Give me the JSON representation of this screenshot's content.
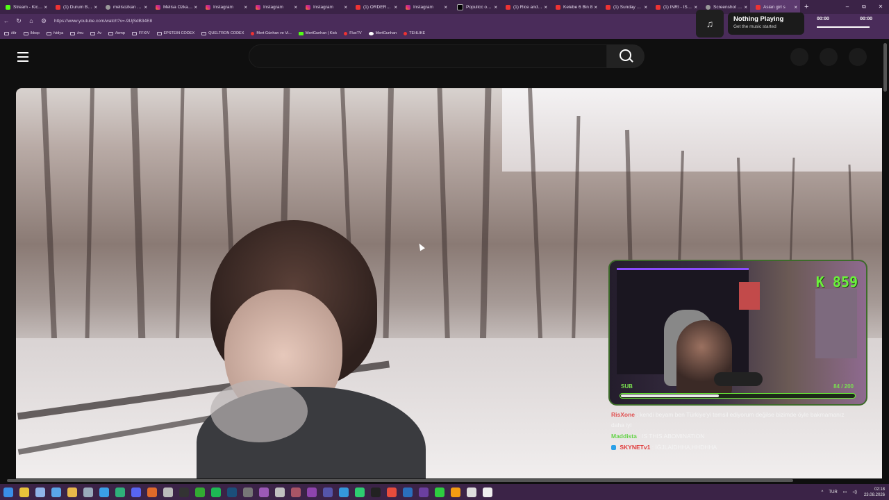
{
  "browser": {
    "tabs": [
      {
        "title": "Stream - Kick Dc",
        "icon": "kick",
        "active": false
      },
      {
        "title": "(1) Durum Boyle",
        "icon": "youtube",
        "active": false
      },
      {
        "title": "melisozkan - Goo",
        "icon": "google",
        "active": false
      },
      {
        "title": "Melisa Ozkan (@",
        "icon": "instagram",
        "active": false
      },
      {
        "title": "Instagram",
        "icon": "instagram",
        "active": false
      },
      {
        "title": "Instagram",
        "icon": "instagram",
        "active": false
      },
      {
        "title": "Instagram",
        "icon": "instagram",
        "active": false
      },
      {
        "title": "(1) ORDERED D",
        "icon": "youtube",
        "active": false
      },
      {
        "title": "Instagram",
        "icon": "instagram",
        "active": false
      },
      {
        "title": "Populicc on X: \"J",
        "icon": "x",
        "active": false
      },
      {
        "title": "(1) Rice and Chi",
        "icon": "youtube",
        "active": false
      },
      {
        "title": "Kelebe 6 Bin 8",
        "icon": "youtube",
        "active": false
      },
      {
        "title": "(1) Sunday dinn",
        "icon": "youtube",
        "active": false
      },
      {
        "title": "(1) INRI - ISTANI",
        "icon": "youtube",
        "active": false
      },
      {
        "title": "Screenshot by Li",
        "icon": "google",
        "active": false
      },
      {
        "title": "Asian girl s",
        "icon": "youtube",
        "active": true
      }
    ],
    "new_tab": "+",
    "window_controls": [
      "–",
      "⧉",
      "✕"
    ],
    "url": "https://www.youtube.com/watch?v=-9UjSdB34E8",
    "bookmarks": [
      {
        "label": "/dir",
        "icon": "folder"
      },
      {
        "label": "/kkop",
        "icon": "folder"
      },
      {
        "label": "/vidya",
        "icon": "folder"
      },
      {
        "label": "/mu",
        "icon": "folder"
      },
      {
        "label": "/tv",
        "icon": "folder"
      },
      {
        "label": "/temp",
        "icon": "folder"
      },
      {
        "label": "FFXIV",
        "icon": "folder"
      },
      {
        "label": "EPSTEIN CODEX",
        "icon": "folder"
      },
      {
        "label": "QUELTRON CODEX",
        "icon": "folder"
      },
      {
        "label": "Mert Günhan ve Vi...",
        "icon": "youtube"
      },
      {
        "label": "MertGunhan | Kick",
        "icon": "kick"
      },
      {
        "label": "FluxTV",
        "icon": "youtube"
      },
      {
        "label": "MertGunhan",
        "icon": "github"
      },
      {
        "label": "TEHLIKE",
        "icon": "youtube"
      }
    ]
  },
  "music_widget": {
    "title": "Nothing Playing",
    "subtitle": "Get the music started",
    "time_current": "00:00",
    "time_total": "00:00",
    "icon": "music-note-icon"
  },
  "youtube": {
    "search_placeholder": "",
    "icons": [
      "menu-icon",
      "search-icon"
    ]
  },
  "webcam_overlay": {
    "counter": "K 859",
    "sub_label": "SUB",
    "sub_progress": "84 / 200",
    "sub_fraction": 0.42,
    "accent": "#6cf23b"
  },
  "chat": [
    {
      "user": "RisXone",
      "sep": ":",
      "message": "kendi beyam ben Türkiye'yi temsil ediyorum değilse bizimde öyle bakmamanız daha iyi",
      "color": "#e05050",
      "badge": false
    },
    {
      "user": "Maddista",
      "sep": ":",
      "message": "IS THIS ABOMINATION",
      "color": "#66d44a",
      "badge": false
    },
    {
      "user": "SKYNETv1",
      "sep": ":",
      "message": "İĞJLAİDHHA,HHDHHA",
      "color": "#e03a3a",
      "badge": true
    }
  ],
  "taskbar": {
    "language": "TUR",
    "time": "02:18",
    "date": "23.08.2026"
  }
}
